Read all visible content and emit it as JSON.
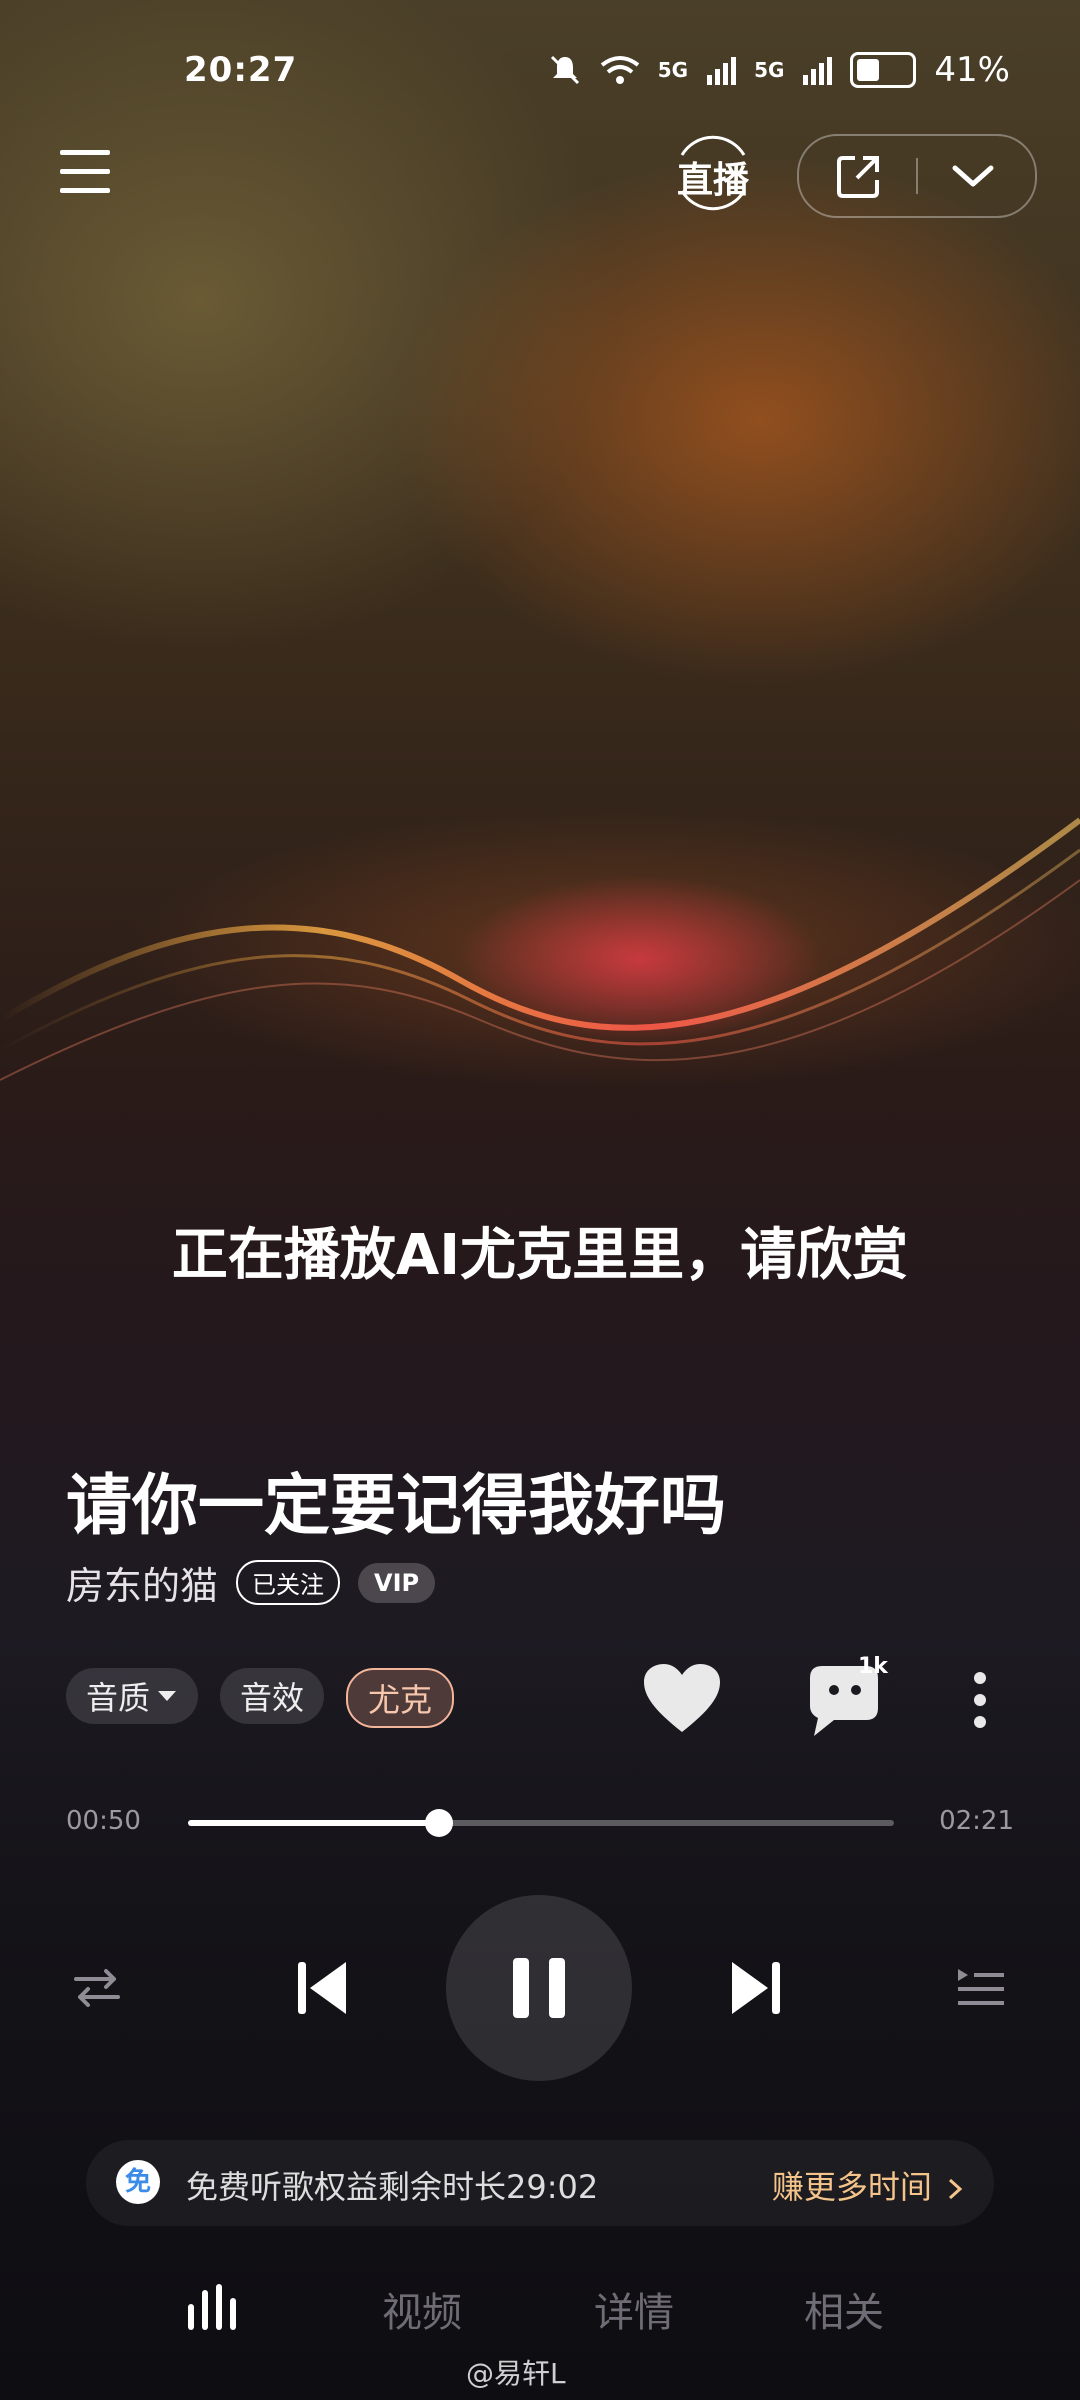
{
  "status_bar": {
    "time": "20:27",
    "network_1": "5G",
    "network_2": "5G",
    "battery": "41%",
    "icons": [
      "mute-icon",
      "wifi-icon",
      "signal-icon",
      "signal-icon",
      "battery-icon"
    ]
  },
  "header": {
    "live_label": "直播",
    "icons": [
      "menu-icon",
      "live-icon",
      "share-icon",
      "chevron-down-icon"
    ]
  },
  "lyrics": {
    "current_line": "正在播放AI尤克里里，请欣赏"
  },
  "song": {
    "title": "请你一定要记得我好吗",
    "artist": "房东的猫",
    "follow_status": "已关注",
    "vip_label": "VIP"
  },
  "options": {
    "quality_label": "音质",
    "effect_label": "音效",
    "style_label": "尤克",
    "comment_count": "1k",
    "colors": {
      "accent_chip": "#f2b59a"
    }
  },
  "progress": {
    "current_time": "00:50",
    "total_time": "02:21",
    "fraction": 0.355
  },
  "controls": {
    "icons": [
      "repeat-icon",
      "previous-icon",
      "pause-icon",
      "next-icon",
      "playlist-icon"
    ]
  },
  "promo": {
    "icon_char": "免",
    "text": "免费听歌权益剩余时长29:02",
    "action": "赚更多时间",
    "action_color": "#f5c48b"
  },
  "tabs": {
    "video": "视频",
    "details": "详情",
    "related": "相关"
  },
  "watermark": "@易轩L"
}
